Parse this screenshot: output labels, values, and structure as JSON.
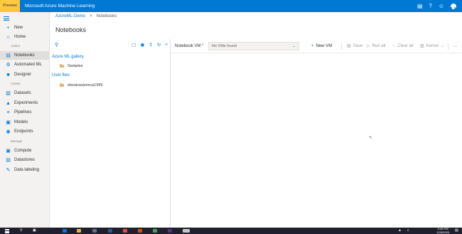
{
  "topbar": {
    "preview_label": "Preview",
    "app_title": "Microsoft Azure Machine Learning",
    "icons": [
      "feedback-icon",
      "help-icon",
      "smiley-icon",
      "account-avatar"
    ],
    "avatar_initials": "LK"
  },
  "sidebar": {
    "items": [
      {
        "label": "New",
        "icon": "plus-icon"
      },
      {
        "label": "Home",
        "icon": "home-icon"
      },
      {
        "label": "Notebooks",
        "icon": "notebook-icon",
        "active": true
      },
      {
        "label": "Automated ML",
        "icon": "automl-icon"
      },
      {
        "label": "Designer",
        "icon": "designer-icon"
      },
      {
        "label": "Datasets",
        "icon": "dataset-icon"
      },
      {
        "label": "Experiments",
        "icon": "experiment-icon"
      },
      {
        "label": "Pipelines",
        "icon": "pipeline-icon"
      },
      {
        "label": "Models",
        "icon": "model-icon"
      },
      {
        "label": "Endpoints",
        "icon": "endpoint-icon"
      },
      {
        "label": "Compute",
        "icon": "compute-icon"
      },
      {
        "label": "Datastores",
        "icon": "datastore-icon"
      },
      {
        "label": "Data labeling",
        "icon": "labeling-icon"
      }
    ],
    "sections": {
      "author": "Author",
      "assets": "Assets",
      "manage": "Manage"
    }
  },
  "breadcrumb": {
    "workspace": "AzureML-Demo",
    "separator": ">",
    "current": "Notebooks"
  },
  "page_title": "Notebooks",
  "file_panel": {
    "gallery_header": "Azure ML gallery",
    "gallery_items": [
      "Samples"
    ],
    "user_header": "User files",
    "user_items": [
      "elavarasanmca1995"
    ]
  },
  "notebook_toolbar": {
    "vm_label": "Notebook VM",
    "vm_required": "*",
    "vm_selected": "No VMs found",
    "new_vm": "New VM",
    "save": "Save",
    "run_all": "Run all",
    "clear_all": "Clear all",
    "kernel": "Kernel",
    "more": "···"
  },
  "taskbar": {
    "time": "5:46 PM",
    "date": "1/28/2020"
  },
  "colors": {
    "accent": "#0078d4",
    "preview_badge": "#ffc83d",
    "sidebar_bg": "#f3f2f1",
    "folder": "#dcb67a",
    "taskbar": "#1f1f2e"
  }
}
